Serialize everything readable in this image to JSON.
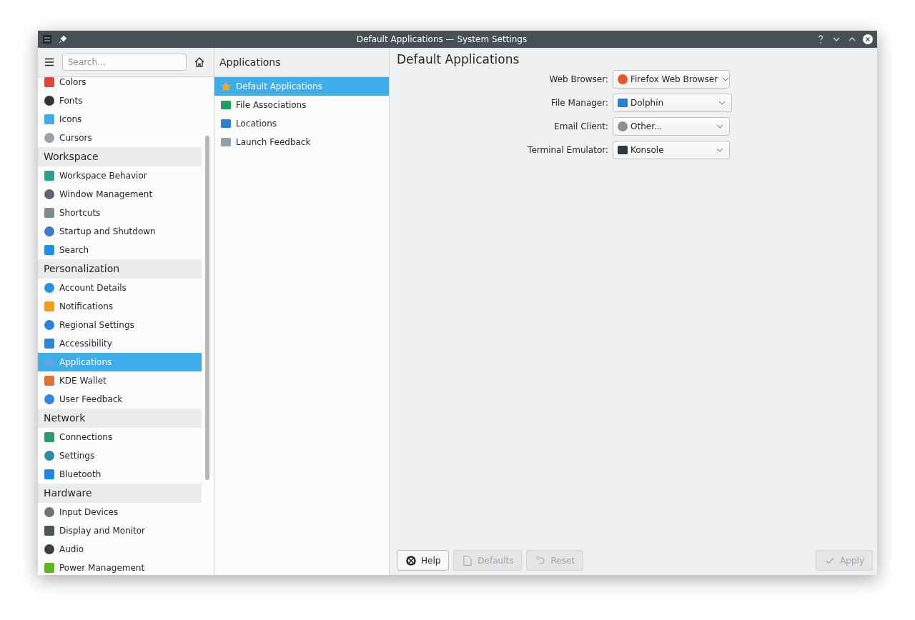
{
  "window": {
    "title": "Default Applications — System Settings"
  },
  "sidebar": {
    "search": {
      "placeholder": "Search..."
    },
    "groups": [
      {
        "items": [
          {
            "label": "Colors",
            "color": "#d9483b",
            "selected": false
          },
          {
            "label": "Fonts",
            "color": "#31363b",
            "selected": false
          },
          {
            "label": "Icons",
            "color": "#3daee9",
            "selected": false
          },
          {
            "label": "Cursors",
            "color": "#9aa3ab",
            "selected": false
          }
        ]
      },
      {
        "title": "Workspace",
        "items": [
          {
            "label": "Workspace Behavior",
            "color": "#2f9e8f",
            "selected": false
          },
          {
            "label": "Window Management",
            "color": "#5d6670",
            "selected": false
          },
          {
            "label": "Shortcuts",
            "color": "#7f8c8d",
            "selected": false
          },
          {
            "label": "Startup and Shutdown",
            "color": "#3b7dc4",
            "selected": false
          },
          {
            "label": "Search",
            "color": "#1e90e8",
            "selected": false
          }
        ]
      },
      {
        "title": "Personalization",
        "items": [
          {
            "label": "Account Details",
            "color": "#2d8fe0",
            "selected": false
          },
          {
            "label": "Notifications",
            "color": "#f0a01c",
            "selected": false
          },
          {
            "label": "Regional Settings",
            "color": "#2a84d8",
            "selected": false
          },
          {
            "label": "Accessibility",
            "color": "#2f86d6",
            "selected": false
          },
          {
            "label": "Applications",
            "color": "#5aa8e8",
            "selected": true
          },
          {
            "label": "KDE Wallet",
            "color": "#e0703a",
            "selected": false
          },
          {
            "label": "User Feedback",
            "color": "#2f8ae0",
            "selected": false
          }
        ]
      },
      {
        "title": "Network",
        "items": [
          {
            "label": "Connections",
            "color": "#2e9a6a",
            "selected": false
          },
          {
            "label": "Settings",
            "color": "#2e8ca0",
            "selected": false
          },
          {
            "label": "Bluetooth",
            "color": "#1e88e5",
            "selected": false
          }
        ]
      },
      {
        "title": "Hardware",
        "items": [
          {
            "label": "Input Devices",
            "color": "#6b737b",
            "selected": false
          },
          {
            "label": "Display and Monitor",
            "color": "#4d555c",
            "selected": false
          },
          {
            "label": "Audio",
            "color": "#3b4045",
            "selected": false
          },
          {
            "label": "Power Management",
            "color": "#5bb520",
            "selected": false
          }
        ]
      }
    ]
  },
  "subcategories": {
    "title": "Applications",
    "items": [
      {
        "label": "Default Applications",
        "color": "#f6a623",
        "selected": true
      },
      {
        "label": "File Associations",
        "color": "#1e9e5a",
        "selected": false
      },
      {
        "label": "Locations",
        "color": "#2a7fcf",
        "selected": false
      },
      {
        "label": "Launch Feedback",
        "color": "#8fa0ad",
        "selected": false
      }
    ]
  },
  "page": {
    "title": "Default Applications",
    "fields": [
      {
        "label": "Web Browser:",
        "value": "Firefox Web Browser",
        "color": "#e8572a"
      },
      {
        "label": "File Manager:",
        "value": "Dolphin",
        "color": "#2a7fcf"
      },
      {
        "label": "Email Client:",
        "value": "Other...",
        "color": "#8a9095"
      },
      {
        "label": "Terminal Emulator:",
        "value": "Konsole",
        "color": "#31363b"
      }
    ],
    "buttons": [
      {
        "kind": "help",
        "label": "Help",
        "disabled": false
      },
      {
        "kind": "defaults",
        "label": "Defaults",
        "disabled": true
      },
      {
        "kind": "reset",
        "label": "Reset",
        "disabled": true
      },
      {
        "kind": "apply",
        "label": "Apply",
        "disabled": true
      }
    ]
  }
}
